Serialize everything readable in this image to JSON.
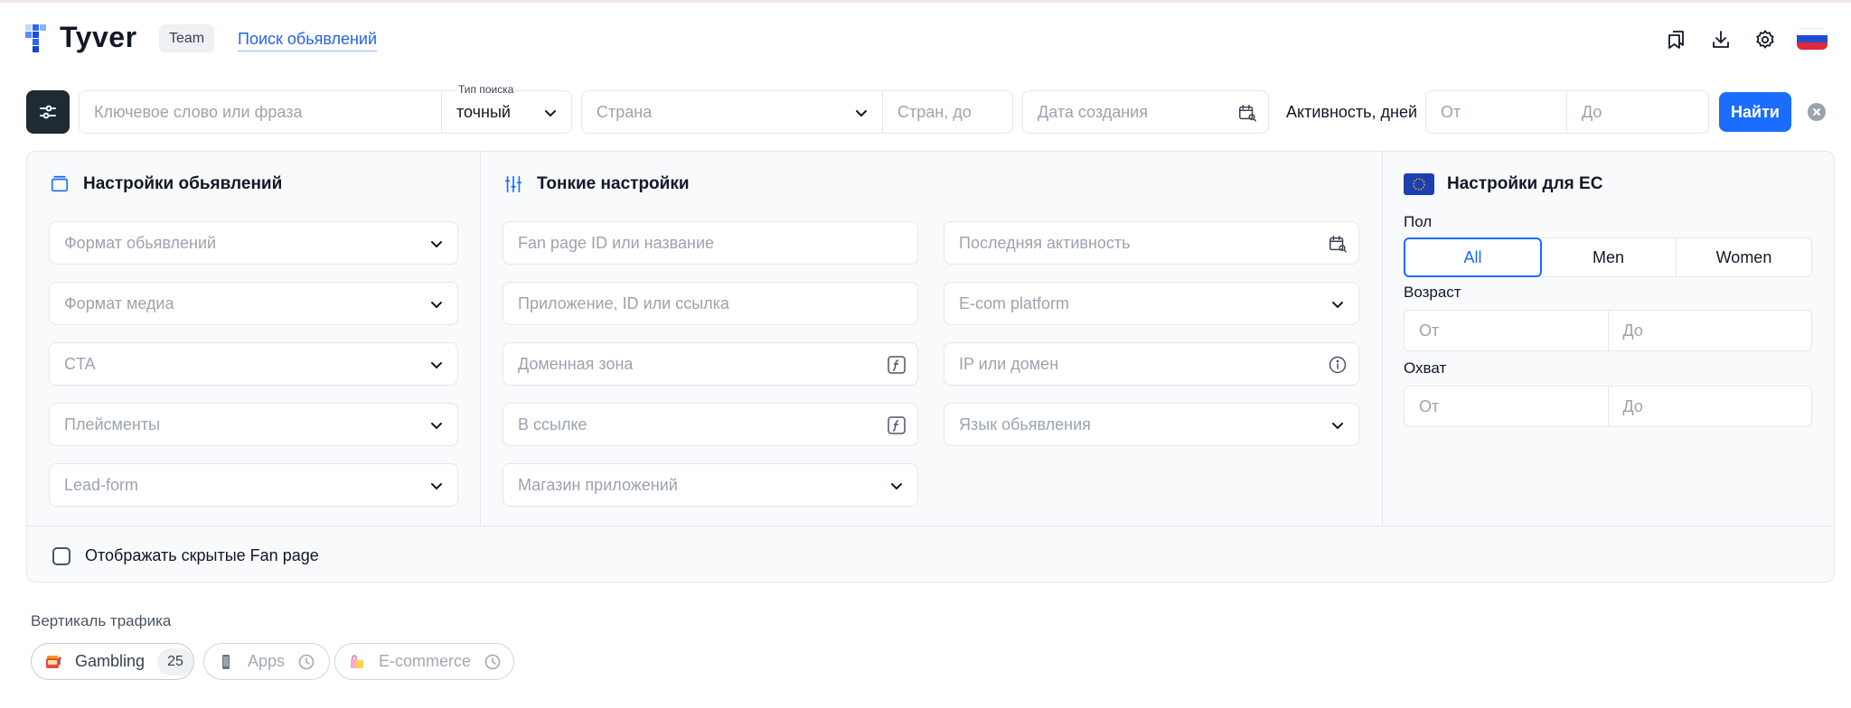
{
  "header": {
    "brand": "Tyver",
    "plan_badge": "Team",
    "nav_link": "Поиск обьявлений",
    "icons": [
      "bookmarks-icon",
      "download-icon",
      "settings-icon",
      "flag-ru-icon"
    ]
  },
  "search_bar": {
    "keyword_placeholder": "Ключевое слово или фраза",
    "search_type_label": "Тип поиска",
    "search_type_value": "точный",
    "country_placeholder": "Страна",
    "country_to_placeholder": "Стран, до",
    "created_date_placeholder": "Дата создания",
    "activity_label": "Активность, дней",
    "activity_from_placeholder": "От",
    "activity_to_placeholder": "До",
    "find_button": "Найти"
  },
  "ad_settings": {
    "title": "Настройки обьявлений",
    "fields": [
      "Формат обьявлений",
      "Формат медиа",
      "CTA",
      "Плейсменты",
      "Lead-form"
    ]
  },
  "fine_settings": {
    "title": "Тонкие настройки",
    "left_fields": [
      "Fan page ID или название",
      "Приложение, ID или ссылка",
      "Доменная зона",
      "В ссылке",
      "Магазин приложений"
    ],
    "right_fields": [
      "Последняя активность",
      "E-com platform",
      "IP или домен",
      "Язык обьявления"
    ]
  },
  "eu_settings": {
    "title": "Настройки для ЕС",
    "gender_label": "Пол",
    "gender_options": [
      "All",
      "Men",
      "Women"
    ],
    "gender_selected": "All",
    "age_label": "Возраст",
    "age_from": "От",
    "age_to": "До",
    "reach_label": "Охват",
    "reach_from": "От",
    "reach_to": "До"
  },
  "footer": {
    "show_hidden_label": "Отображать скрытые Fan page",
    "show_hidden_checked": false
  },
  "traffic_vertical": {
    "title": "Вертикаль трафика",
    "chips": [
      {
        "label": "Gambling",
        "count": "25",
        "state": "active"
      },
      {
        "label": "Apps",
        "state": "coming-soon"
      },
      {
        "label": "E-commerce",
        "state": "coming-soon"
      }
    ]
  },
  "colors": {
    "accent": "#1a6dff",
    "dark": "#1f2a37",
    "panel_bg": "#f8fafc",
    "border": "#e5e7eb"
  }
}
